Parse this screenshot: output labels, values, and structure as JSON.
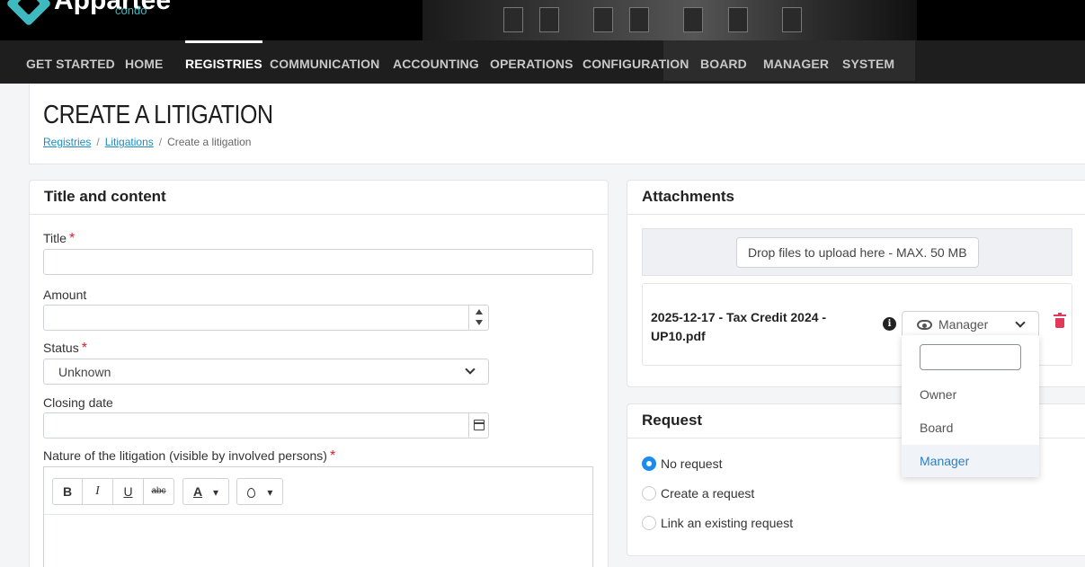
{
  "brand": {
    "name": "Appartee",
    "sub": "condo"
  },
  "nav": {
    "items": [
      {
        "label": "GET STARTED",
        "active": false
      },
      {
        "label": "HOME",
        "active": false
      },
      {
        "label": "REGISTRIES",
        "active": true
      },
      {
        "label": "COMMUNICATION",
        "active": false
      },
      {
        "label": "ACCOUNTING",
        "active": false
      },
      {
        "label": "OPERATIONS",
        "active": false
      },
      {
        "label": "CONFIGURATION",
        "active": false
      },
      {
        "label": "BOARD",
        "active": false
      },
      {
        "label": "MANAGER",
        "active": false
      },
      {
        "label": "SYSTEM",
        "active": false
      }
    ]
  },
  "page": {
    "title": "CREATE A LITIGATION",
    "breadcrumb": [
      {
        "label": "Registries",
        "link": true
      },
      {
        "label": "Litigations",
        "link": true
      },
      {
        "label": "Create a litigation",
        "link": false
      }
    ]
  },
  "form": {
    "section_title": "Title and content",
    "title_label": "Title",
    "title_value": "",
    "amount_label": "Amount",
    "amount_value": "",
    "status_label": "Status",
    "status_value": "Unknown",
    "closing_label": "Closing date",
    "closing_value": "",
    "nature_label": "Nature of the litigation (visible by involved persons)",
    "required_mark": "*",
    "toolbar": {
      "bold": "B",
      "italic": "I",
      "underline": "U",
      "strike": "abc",
      "font_color": "A",
      "caret": "▾"
    }
  },
  "attachments": {
    "section_title": "Attachments",
    "drop_label": "Drop files to upload here - MAX. 50 MB",
    "file": {
      "name": "2025-12-17 - Tax Credit 2024 - UP10.pdf",
      "visibility": "Manager"
    },
    "visibility_options": [
      "Owner",
      "Board",
      "Manager"
    ],
    "visibility_search": "",
    "accent_color": "#2f7fc0"
  },
  "request": {
    "section_title": "Request",
    "options": [
      {
        "label": "No request",
        "checked": true
      },
      {
        "label": "Create a request",
        "checked": false
      },
      {
        "label": "Link an existing request",
        "checked": false
      }
    ]
  }
}
